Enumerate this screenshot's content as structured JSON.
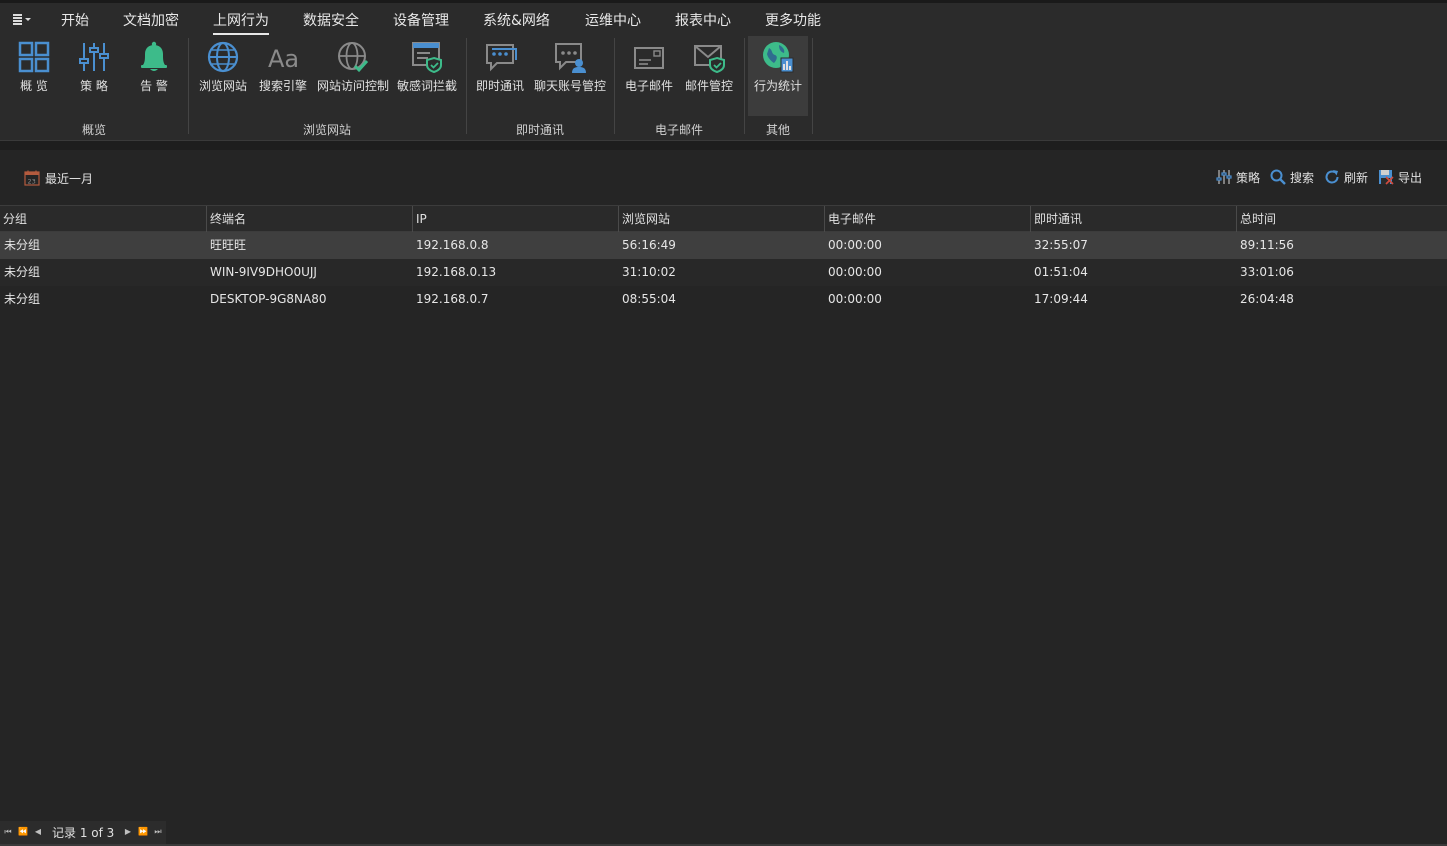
{
  "menu": {
    "tabs": [
      "开始",
      "文档加密",
      "上网行为",
      "数据安全",
      "设备管理",
      "系统&网络",
      "运维中心",
      "报表中心",
      "更多功能"
    ],
    "active": "上网行为"
  },
  "ribbon": {
    "groups": [
      {
        "label": "概览",
        "buttons": [
          {
            "label": "概 览",
            "icon": "grid-overview-icon"
          },
          {
            "label": "策 略",
            "icon": "sliders-icon"
          },
          {
            "label": "告 警",
            "icon": "bell-icon"
          }
        ]
      },
      {
        "label": "浏览网站",
        "buttons": [
          {
            "label": "浏览网站",
            "icon": "globe-icon"
          },
          {
            "label": "搜索引擎",
            "icon": "font-aa-icon"
          },
          {
            "label": "网站访问控制",
            "icon": "globe-check-icon"
          },
          {
            "label": "敏感词拦截",
            "icon": "browser-shield-icon"
          }
        ]
      },
      {
        "label": "即时通讯",
        "buttons": [
          {
            "label": "即时通讯",
            "icon": "chat-bubble-icon"
          },
          {
            "label": "聊天账号管控",
            "icon": "chat-user-icon"
          }
        ]
      },
      {
        "label": "电子邮件",
        "buttons": [
          {
            "label": "电子邮件",
            "icon": "envelope-icon"
          },
          {
            "label": "邮件管控",
            "icon": "envelope-shield-icon"
          }
        ]
      },
      {
        "label": "其他",
        "buttons": [
          {
            "label": "行为统计",
            "icon": "globe-stats-icon",
            "selected": true
          }
        ]
      }
    ]
  },
  "toolbar": {
    "date_filter": "最近一月",
    "calendar_day": "23",
    "actions": [
      {
        "label": "策略",
        "icon": "sliders-icon"
      },
      {
        "label": "搜索",
        "icon": "search-icon"
      },
      {
        "label": "刷新",
        "icon": "refresh-icon"
      },
      {
        "label": "导出",
        "icon": "export-icon"
      }
    ]
  },
  "table": {
    "columns": [
      "分组",
      "终端名",
      "IP",
      "浏览网站",
      "电子邮件",
      "即时通讯",
      "总时间"
    ],
    "rows": [
      [
        "未分组",
        "旺旺旺",
        "192.168.0.8",
        "56:16:49",
        "00:00:00",
        "32:55:07",
        "89:11:56"
      ],
      [
        "未分组",
        "WIN-9IV9DHO0UJJ",
        "192.168.0.13",
        "31:10:02",
        "00:00:00",
        "01:51:04",
        "33:01:06"
      ],
      [
        "未分组",
        "DESKTOP-9G8NA80",
        "192.168.0.7",
        "08:55:04",
        "00:00:00",
        "17:09:44",
        "26:04:48"
      ]
    ],
    "selected_row": 0
  },
  "status": {
    "record_text": "记录 1 of 3",
    "nav_glyphs": [
      "⏮",
      "⏪",
      "◀",
      "▶",
      "⏩",
      "⏭"
    ]
  },
  "colors": {
    "accent_blue": "#3f88c5",
    "accent_green": "#3dbb8a",
    "background": "#252525"
  }
}
